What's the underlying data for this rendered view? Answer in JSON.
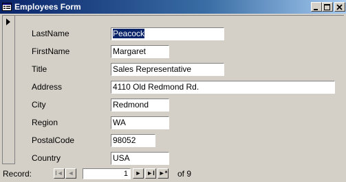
{
  "window": {
    "title": "Employees Form",
    "icon": "form-icon",
    "controls": {
      "minimize": "_",
      "maximize": "□",
      "close": "×"
    }
  },
  "record_selector": {
    "icon": "current-record-arrow-icon"
  },
  "fields": [
    {
      "label": "LastName",
      "value": "Peacock"
    },
    {
      "label": "FirstName",
      "value": "Margaret"
    },
    {
      "label": "Title",
      "value": "Sales Representative"
    },
    {
      "label": "Address",
      "value": "4110 Old Redmond Rd."
    },
    {
      "label": "City",
      "value": "Redmond"
    },
    {
      "label": "Region",
      "value": "WA"
    },
    {
      "label": "PostalCode",
      "value": "98052"
    },
    {
      "label": "Country",
      "value": "USA"
    }
  ],
  "navigation": {
    "label": "Record:",
    "first": "I◄",
    "previous": "◄",
    "current": "1",
    "next": "►",
    "last": "►I",
    "new": "►*",
    "of_text": "of 9"
  },
  "colors": {
    "titlebar_start": "#0a246a",
    "titlebar_end": "#a6caf0",
    "face": "#d4d0c8",
    "selection": "#0a246a"
  }
}
